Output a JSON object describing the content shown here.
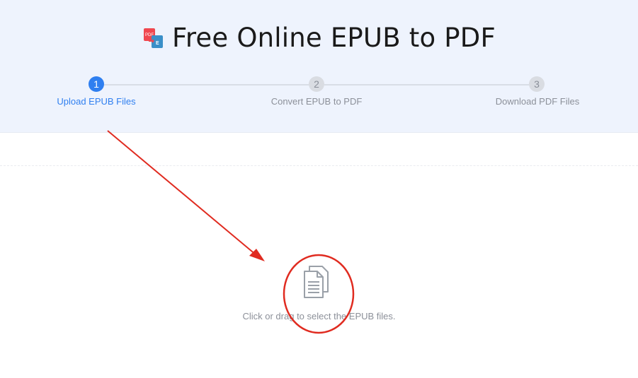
{
  "header": {
    "title": "Free Online EPUB to PDF",
    "logo_icon": "pdf-epub-convert-icon",
    "logo_text": "PDF"
  },
  "steps": [
    {
      "number": "1",
      "label": "Upload EPUB Files",
      "state": "active"
    },
    {
      "number": "2",
      "label": "Convert EPUB to PDF",
      "state": "inactive"
    },
    {
      "number": "3",
      "label": "Download PDF Files",
      "state": "inactive"
    }
  ],
  "upload": {
    "icon": "documents-icon",
    "instruction": "Click or drag to select the EPUB files."
  },
  "colors": {
    "accent": "#2f7ff0",
    "hero_bg": "#eef3fd",
    "annotation": "#e02b20"
  }
}
